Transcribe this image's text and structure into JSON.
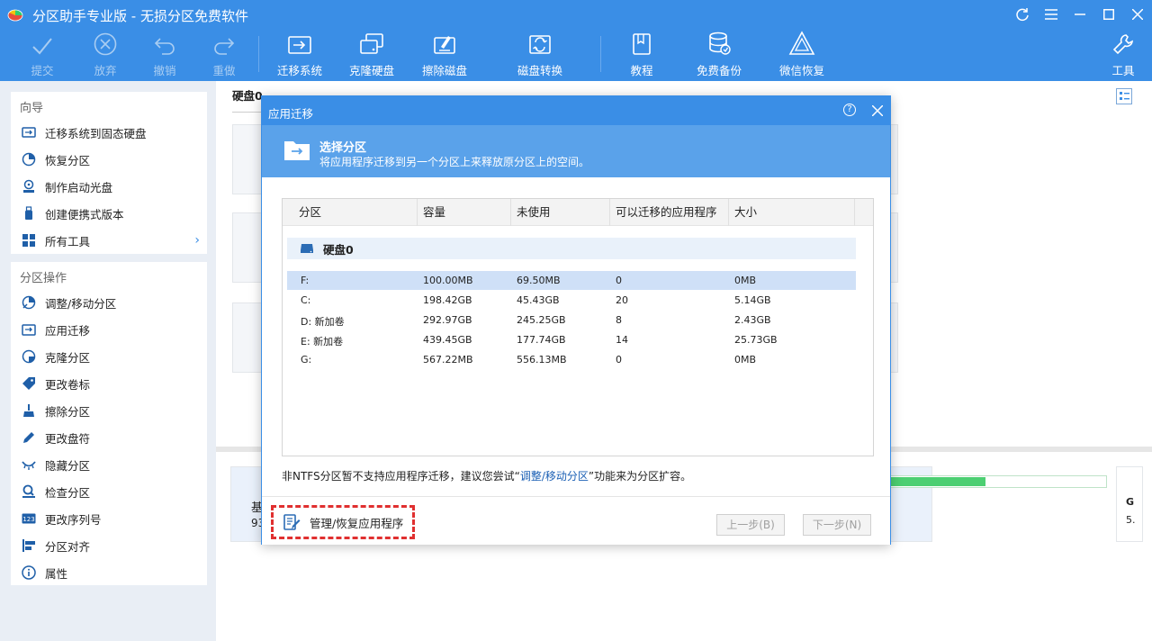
{
  "app": {
    "title": "分区助手专业版 - 无损分区免费软件"
  },
  "toolbar": {
    "commit": "提交",
    "discard": "放弃",
    "undo": "撤销",
    "redo": "重做",
    "migrate_os": "迁移系统",
    "clone_disk": "克隆硬盘",
    "wipe_disk": "擦除磁盘",
    "disk_convert": "磁盘转换",
    "tutorial": "教程",
    "free_backup": "免费备份",
    "wechat_recover": "微信恢复",
    "tools": "工具"
  },
  "sidebar": {
    "wizard_title": "向导",
    "wizard_items": [
      "迁移系统到固态硬盘",
      "恢复分区",
      "制作启动光盘",
      "创建便携式版本",
      "所有工具"
    ],
    "ops_title": "分区操作",
    "ops_items": [
      "调整/移动分区",
      "应用迁移",
      "克隆分区",
      "更改卷标",
      "擦除分区",
      "更改盘符",
      "隐藏分区",
      "检查分区",
      "更改序列号",
      "分区对齐",
      "属性"
    ]
  },
  "main": {
    "disk_label": "硬盘0",
    "bottom_fragment_1": "基",
    "bottom_fragment_2": "93",
    "right_fragment_1": "G",
    "right_fragment_2": "5."
  },
  "dialog": {
    "title": "应用迁移",
    "help": "?",
    "banner_title": "选择分区",
    "banner_subtitle": "将应用程序迁移到另一个分区上来释放原分区上的空间。",
    "columns": [
      "分区",
      "容量",
      "未使用",
      "可以迁移的应用程序",
      "大小"
    ],
    "disk_name": "硬盘0",
    "rows": [
      {
        "part": "F:",
        "cap": "100.00MB",
        "free": "69.50MB",
        "apps": "0",
        "size": "0MB"
      },
      {
        "part": "C:",
        "cap": "198.42GB",
        "free": "45.43GB",
        "apps": "20",
        "size": "5.14GB"
      },
      {
        "part": "D:  新加卷",
        "cap": "292.97GB",
        "free": "245.25GB",
        "apps": "8",
        "size": "2.43GB"
      },
      {
        "part": "E:  新加卷",
        "cap": "439.45GB",
        "free": "177.74GB",
        "apps": "14",
        "size": "25.73GB"
      },
      {
        "part": "G:",
        "cap": "567.22MB",
        "free": "556.13MB",
        "apps": "0",
        "size": "0MB"
      }
    ],
    "note_prefix": "非NTFS分区暂不支持应用程序迁移，建议您尝试“",
    "note_link": "调整/移动分区",
    "note_suffix": "”功能来为分区扩容。",
    "manage_label": "管理/恢复应用程序",
    "prev_button": "上一步(B)",
    "next_button": "下一步(N)"
  },
  "usage_bar": {
    "fill_fraction": 0.44
  },
  "colors": {
    "accent": "#3a8ee6",
    "banner": "#5aa2ea",
    "selected_row": "#cfe0f7",
    "highlight_border": "#e03030",
    "usage_bar": "#4ccf72"
  }
}
